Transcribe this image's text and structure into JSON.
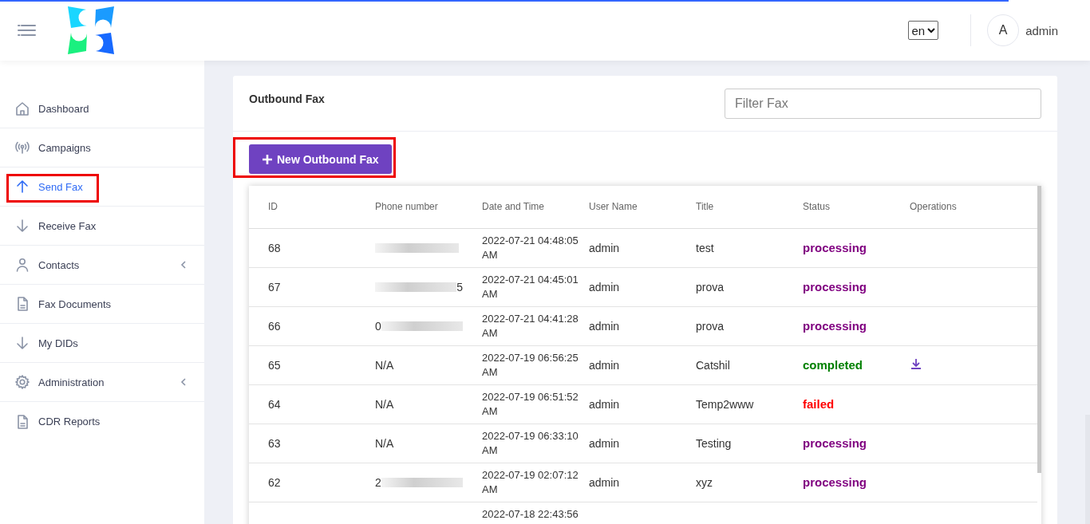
{
  "header": {
    "language": "en",
    "avatar_letter": "A",
    "user": "admin"
  },
  "sidebar": {
    "items": [
      {
        "label": "Dashboard",
        "kind": "home",
        "selected": false,
        "submenu": false,
        "highlighted": false
      },
      {
        "label": "Campaigns",
        "kind": "broadcast",
        "selected": false,
        "submenu": false,
        "highlighted": false
      },
      {
        "label": "Send Fax",
        "kind": "up",
        "selected": true,
        "submenu": false,
        "highlighted": true
      },
      {
        "label": "Receive Fax",
        "kind": "down",
        "selected": false,
        "submenu": false,
        "highlighted": false
      },
      {
        "label": "Contacts",
        "kind": "person",
        "selected": false,
        "submenu": true,
        "highlighted": false
      },
      {
        "label": "Fax Documents",
        "kind": "document",
        "selected": false,
        "submenu": false,
        "highlighted": false
      },
      {
        "label": "My DIDs",
        "kind": "down",
        "selected": false,
        "submenu": false,
        "highlighted": false
      },
      {
        "label": "Administration",
        "kind": "gear",
        "selected": false,
        "submenu": true,
        "highlighted": false
      },
      {
        "label": "CDR Reports",
        "kind": "document",
        "selected": false,
        "submenu": false,
        "highlighted": false
      }
    ]
  },
  "panel": {
    "title": "Outbound Fax",
    "filter": {
      "placeholder": "Filter Fax"
    },
    "new_button": {
      "label": "New Outbound Fax",
      "highlighted": true
    },
    "table": {
      "columns": [
        "ID",
        "Phone number",
        "Date and Time",
        "User Name",
        "Title",
        "Status",
        "Operations"
      ],
      "rows": [
        {
          "id": "68",
          "phone": {
            "redacted": true
          },
          "date": "2022-07-21 04:48:05",
          "ampm": "AM",
          "user": "admin",
          "title": "test",
          "status": "processing",
          "download": false
        },
        {
          "id": "67",
          "phone": {
            "redacted": true,
            "suffix": "5"
          },
          "date": "2022-07-21 04:45:01",
          "ampm": "AM",
          "user": "admin",
          "title": "prova",
          "status": "processing",
          "download": false
        },
        {
          "id": "66",
          "phone": {
            "prefix": "0",
            "redacted": true
          },
          "date": "2022-07-21 04:41:28",
          "ampm": "AM",
          "user": "admin",
          "title": "prova",
          "status": "processing",
          "download": false
        },
        {
          "id": "65",
          "phone": {
            "prefix": "N/A",
            "redacted": false
          },
          "date": "2022-07-19 06:56:25",
          "ampm": "AM",
          "user": "admin",
          "title": "Catshil",
          "status": "completed",
          "download": true
        },
        {
          "id": "64",
          "phone": {
            "prefix": "N/A",
            "redacted": false
          },
          "date": "2022-07-19 06:51:52",
          "ampm": "AM",
          "user": "admin",
          "title": "Temp2www",
          "status": "failed",
          "download": false
        },
        {
          "id": "63",
          "phone": {
            "prefix": "N/A",
            "redacted": false
          },
          "date": "2022-07-19 06:33:10",
          "ampm": "AM",
          "user": "admin",
          "title": "Testing",
          "status": "processing",
          "download": false
        },
        {
          "id": "62",
          "phone": {
            "prefix": "2",
            "redacted": true
          },
          "date": "2022-07-19 02:07:12",
          "ampm": "AM",
          "user": "admin",
          "title": "xyz",
          "status": "processing",
          "download": false
        },
        {
          "date": "2022-07-18 22:43:56"
        }
      ]
    }
  }
}
